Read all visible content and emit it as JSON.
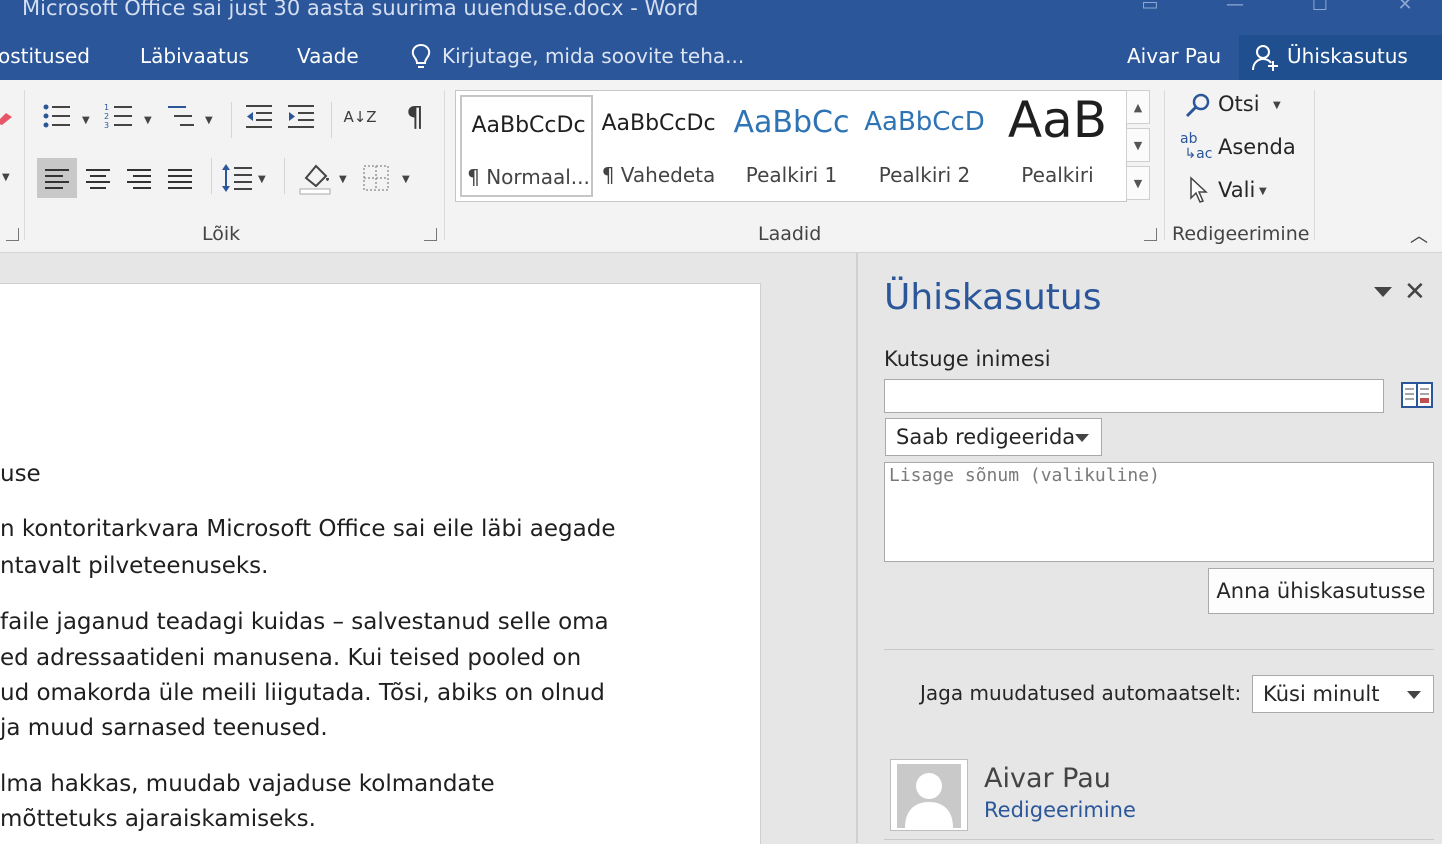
{
  "window": {
    "title": "Microsoft Office sai just 30 aasta suurima uuenduse.docx - Word"
  },
  "menu": {
    "tabs": [
      "ostitused",
      "Läbivaatus",
      "Vaade"
    ],
    "tell_me": "Kirjutage, mida soovite teha...",
    "user": "Aivar Pau",
    "share": "Ühiskasutus"
  },
  "ribbon": {
    "paragraph_label": "Lõik",
    "styles_label": "Laadid",
    "editing_label": "Redigeerimine",
    "styles": [
      {
        "sample": "AaBbCcDc",
        "name": "¶ Normaal..."
      },
      {
        "sample": "AaBbCcDc",
        "name": "¶ Vahedeta"
      },
      {
        "sample": "AaBbCc",
        "name": "Pealkiri 1"
      },
      {
        "sample": "AaBbCcD",
        "name": "Pealkiri 2"
      },
      {
        "sample": "AaB",
        "name": "Pealkiri"
      }
    ],
    "editing": {
      "find": "Otsi",
      "replace": "Asenda",
      "select": "Vali"
    },
    "icon_glyphs": {
      "sort": "A↓Z",
      "pilcrow": "¶",
      "replace_icon": "ab→ac"
    }
  },
  "document": {
    "paragraphs": [
      "use",
      "n kontoritarkvara Microsoft Office sai eile läbi aegade",
      "ntavalt pilveteenuseks.",
      " faile jaganud teadagi kuidas – salvestanud selle oma",
      "ed adressaatideni manusena. Kui teised pooled on",
      "ud omakorda üle meili liigutada. Tõsi, abiks on olnud",
      " ja muud sarnased teenused.",
      "lma hakkas, muudab vajaduse kolmandate",
      "mõttetuks ajaraiskamiseks."
    ]
  },
  "share_pane": {
    "title": "Ühiskasutus",
    "invite_label": "Kutsuge inimesi",
    "invite_value": "",
    "permission": "Saab redigeerida",
    "message_placeholder": "Lisage sõnum (valikuline)",
    "share_button": "Anna ühiskasutusse",
    "auto_share_label": "Jaga muudatused automaatselt:",
    "auto_share_value": "Küsi minult",
    "person": {
      "name": "Aivar Pau",
      "role": "Redigeerimine"
    },
    "close_glyph": "✕"
  },
  "colors": {
    "accent": "#2b579a",
    "pane_title": "#2b579a",
    "link": "#2b579a"
  }
}
